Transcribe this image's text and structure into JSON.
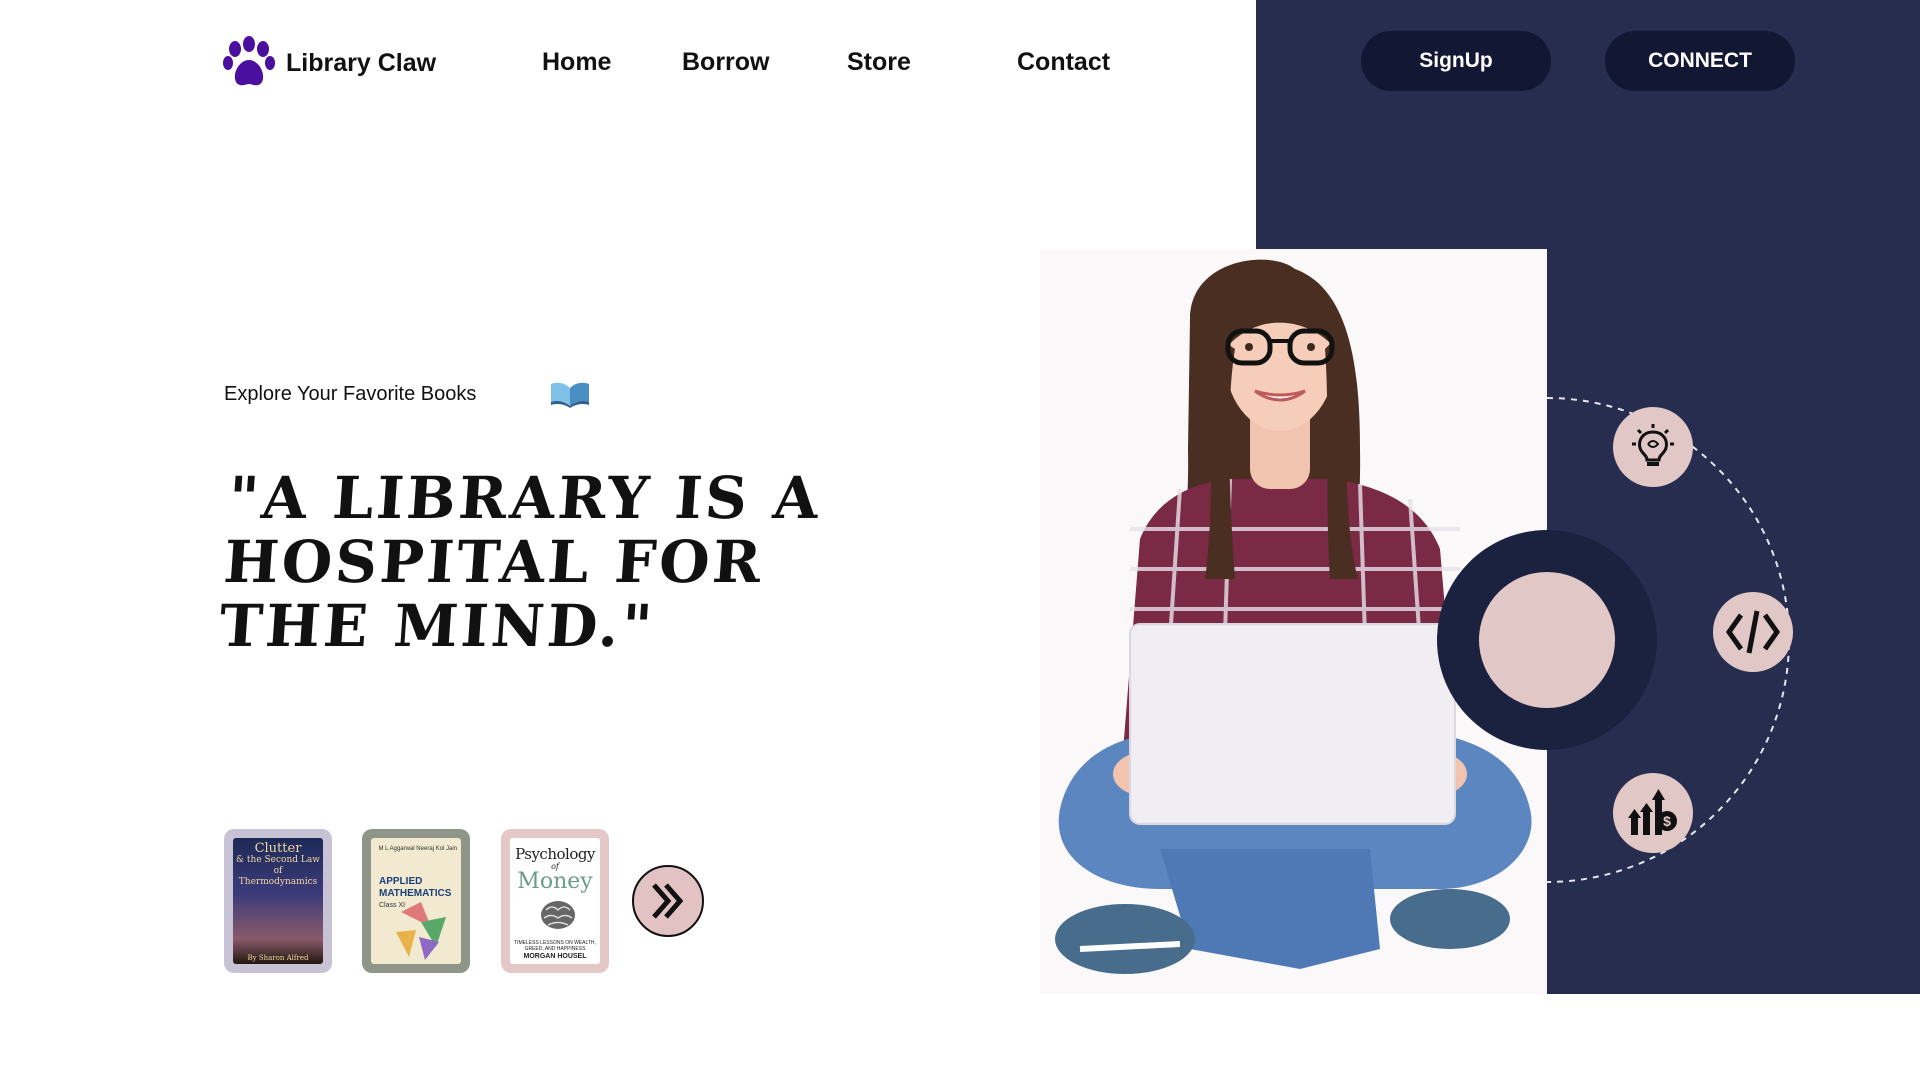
{
  "brand": {
    "name": "Library Claw",
    "icon": "paw-icon",
    "color": "#4b0fa0"
  },
  "nav": {
    "items": [
      "Home",
      "Borrow",
      "Store",
      "Contact"
    ]
  },
  "actions": {
    "signup": "SignUp",
    "connect": "CONNECT"
  },
  "hero": {
    "kicker": "Explore Your Favorite Books",
    "kicker_icon": "open-book-icon",
    "quote": "\"A LIBRARY IS A HOSPITAL FOR THE MIND.\""
  },
  "books": [
    {
      "title": "Clutter",
      "subtitle": "& the Second Law of Thermodynamics",
      "author": "By Sharon Alfred"
    },
    {
      "title": "APPLIED MATHEMATICS",
      "subtitle": "Class XI",
      "authors": "M L Aggarwal  Neeraj Kol Jain"
    },
    {
      "title_1": "Psychology",
      "title_2": "of",
      "title_3": "Money",
      "subtitle": "TIMELESS LESSONS ON WEALTH, GREED, AND HAPPINESS",
      "author": "MORGAN HOUSEL"
    }
  ],
  "next_icon": "double-chevron-right-icon",
  "features": [
    "lightbulb-brain-icon",
    "code-icon",
    "growth-dollar-icon"
  ],
  "colors": {
    "navy": "#262d4f",
    "button": "#121733",
    "accent_pink": "#e2c7c7"
  }
}
